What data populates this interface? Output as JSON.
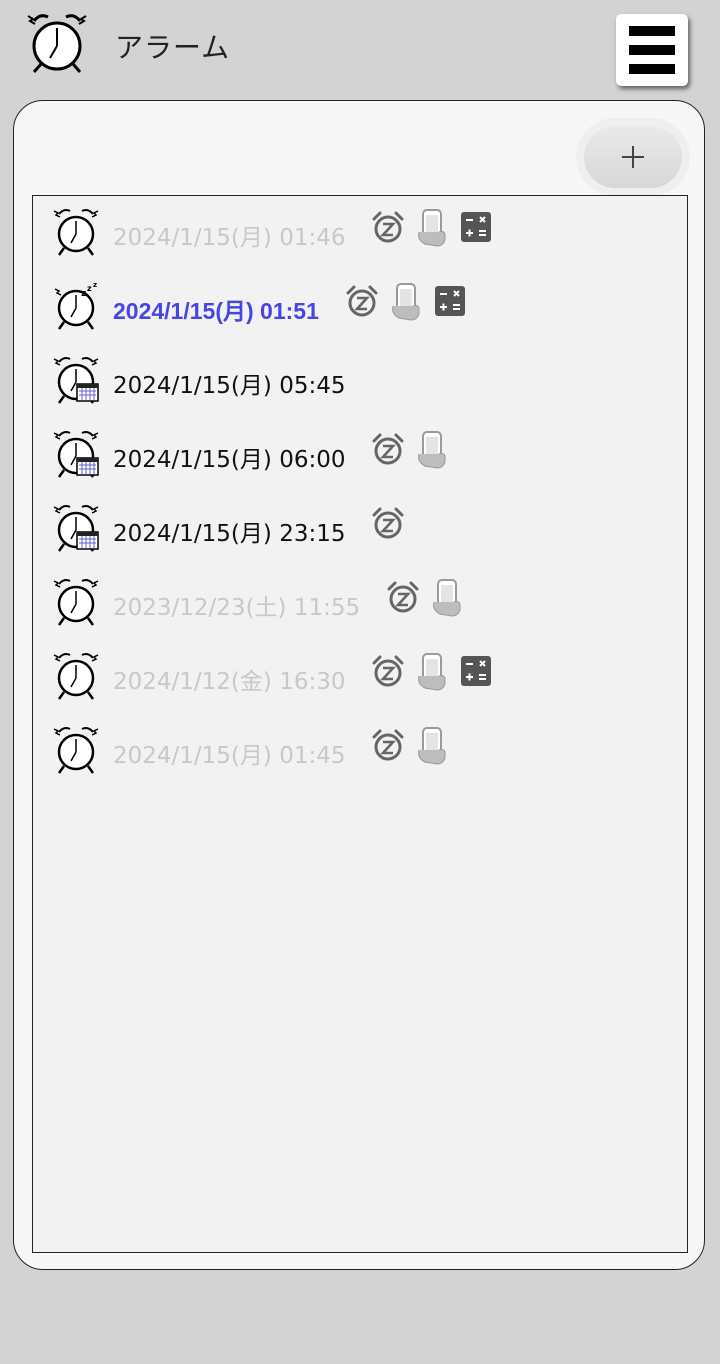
{
  "app": {
    "title": "アラーム",
    "app_icon": "alarm-clock-icon",
    "menu_icon": "hamburger-menu-icon",
    "add_icon": "plus-icon"
  },
  "colors": {
    "background": "#d3d3d3",
    "card": "#f7f7f7",
    "list": "#f2f2f2",
    "active_text": "#4646e6",
    "disabled_text": "#c8c8c8",
    "normal_text": "#111111",
    "badge": "#666666"
  },
  "alarms": [
    {
      "time": "2024/1/15(月) 01:46",
      "state": "disabled",
      "icon": "alarm-clock-icon",
      "badges": [
        "snooze-icon",
        "phone-shake-icon",
        "calculator-icon"
      ]
    },
    {
      "time": "2024/1/15(月) 01:51",
      "state": "snoozing",
      "icon": "alarm-clock-sleeping-icon",
      "badges": [
        "snooze-icon",
        "phone-shake-icon",
        "calculator-icon"
      ]
    },
    {
      "time": "2024/1/15(月) 05:45",
      "state": "enabled",
      "icon": "alarm-clock-calendar-icon",
      "badges": []
    },
    {
      "time": "2024/1/15(月) 06:00",
      "state": "enabled",
      "icon": "alarm-clock-calendar-icon",
      "badges": [
        "snooze-icon",
        "phone-shake-icon"
      ]
    },
    {
      "time": "2024/1/15(月) 23:15",
      "state": "enabled",
      "icon": "alarm-clock-calendar-icon",
      "badges": [
        "snooze-icon"
      ]
    },
    {
      "time": "2023/12/23(土) 11:55",
      "state": "disabled",
      "icon": "alarm-clock-icon",
      "badges": [
        "snooze-icon",
        "phone-shake-icon"
      ]
    },
    {
      "time": "2024/1/12(金) 16:30",
      "state": "disabled",
      "icon": "alarm-clock-icon",
      "badges": [
        "snooze-icon",
        "phone-shake-icon",
        "calculator-icon"
      ]
    },
    {
      "time": "2024/1/15(月) 01:45",
      "state": "disabled",
      "icon": "alarm-clock-icon",
      "badges": [
        "snooze-icon",
        "phone-shake-icon"
      ]
    }
  ]
}
